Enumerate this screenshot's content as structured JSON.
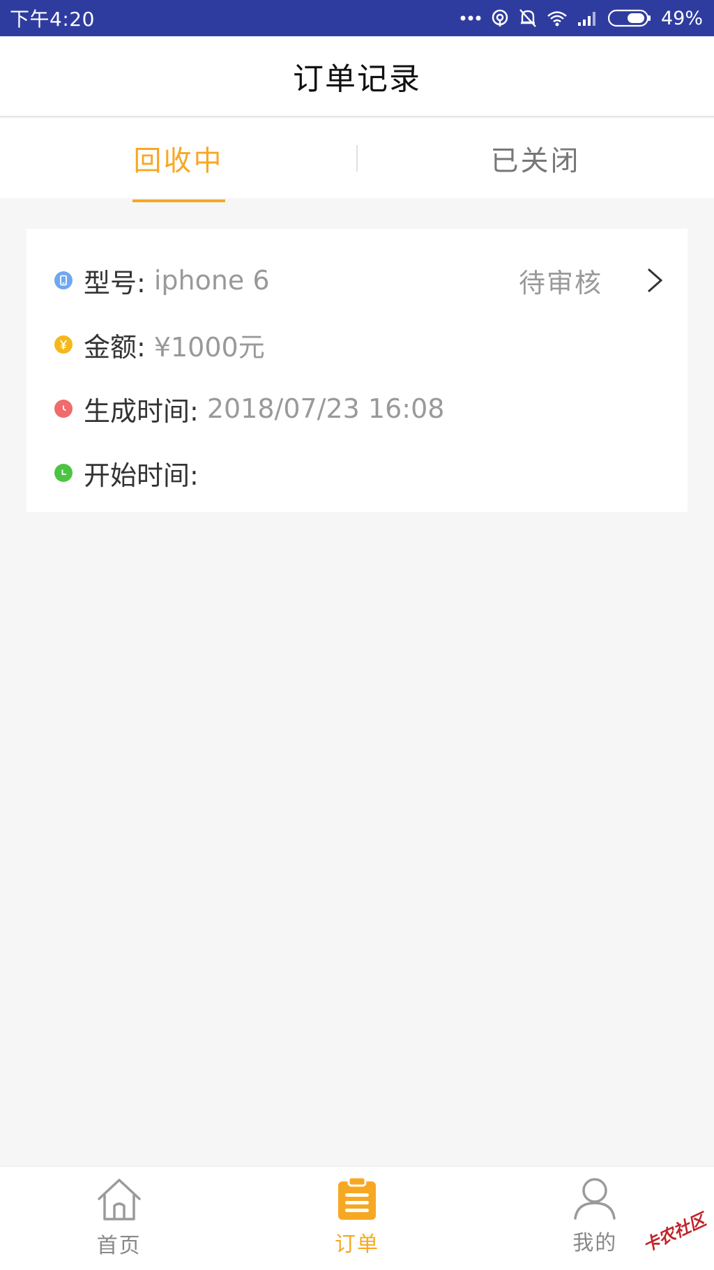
{
  "status_bar": {
    "time": "下午4:20",
    "battery": "49%",
    "icons": [
      "more-dots-icon",
      "hotspot-icon",
      "mute-bell-icon",
      "wifi-icon",
      "signal-icon",
      "battery-icon"
    ]
  },
  "header": {
    "title": "订单记录"
  },
  "tabs": [
    {
      "label": "回收中",
      "active": true
    },
    {
      "label": "已关闭",
      "active": false
    }
  ],
  "order": {
    "model_label": "型号:",
    "model_value": "iphone 6",
    "status": "待审核",
    "amount_label": "金额:",
    "amount_value": "¥1000元",
    "created_label": "生成时间:",
    "created_value": "2018/07/23 16:08",
    "start_label": "开始时间:",
    "start_value": ""
  },
  "bottom_nav": [
    {
      "label": "首页",
      "icon": "home-icon",
      "active": false
    },
    {
      "label": "订单",
      "icon": "clipboard-icon",
      "active": true
    },
    {
      "label": "我的",
      "icon": "user-icon",
      "active": false
    }
  ],
  "watermark": "卡农社区",
  "colors": {
    "status_bar": "#2f3c9f",
    "accent": "#f7a823",
    "model_icon": "#6ea8f0",
    "amount_icon": "#f5b81c",
    "time_icon": "#f06b6b",
    "start_icon": "#4cc443"
  }
}
